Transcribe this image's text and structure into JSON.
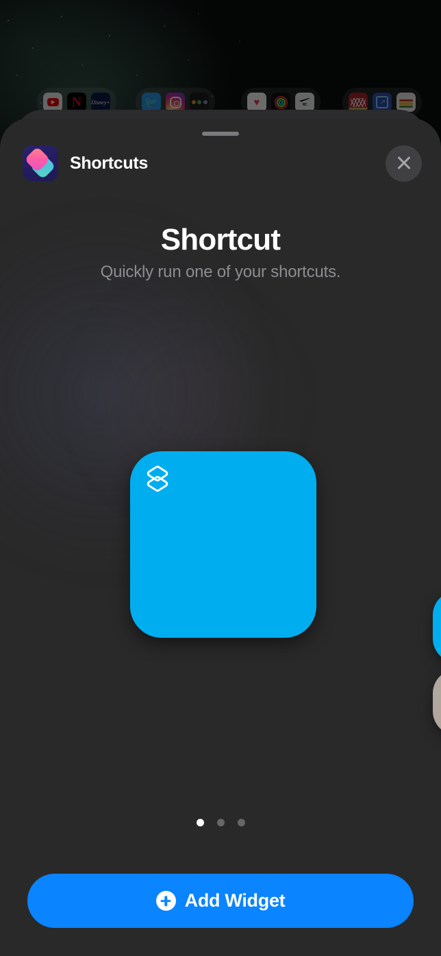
{
  "wallpaper": {
    "description": "dark starfield night sky",
    "home_screen_groups": [
      {
        "name": "entertainment-folder",
        "apps": [
          {
            "name": "YouTube",
            "icon": "youtube-icon"
          },
          {
            "name": "Netflix",
            "icon": "netflix-icon",
            "glyph": "N"
          },
          {
            "name": "Disney+",
            "icon": "disney-plus-icon",
            "glyph": "Disney+"
          }
        ]
      },
      {
        "name": "social-folder",
        "apps": [
          {
            "name": "Twitter",
            "icon": "twitter-icon",
            "glyph": "🐦"
          },
          {
            "name": "Instagram",
            "icon": "instagram-icon"
          },
          {
            "name": "Slack",
            "icon": "dots-icon"
          }
        ]
      },
      {
        "name": "fitness-folder",
        "apps": [
          {
            "name": "Health",
            "icon": "health-heart-icon",
            "glyph": "♥"
          },
          {
            "name": "Fitness",
            "icon": "activity-rings-icon"
          },
          {
            "name": "Nike Run Club",
            "icon": "nike-run-club-icon",
            "glyph": "RC"
          }
        ]
      },
      {
        "name": "utilities-folder",
        "apps": [
          {
            "name": "Red App",
            "icon": "red-app-icon"
          },
          {
            "name": "Blue App",
            "icon": "blue-app-icon",
            "glyph": "↗"
          },
          {
            "name": "Wallet",
            "icon": "wallet-icon"
          }
        ]
      }
    ]
  },
  "sheet": {
    "grabber": "drag-handle",
    "header": {
      "app_icon": "shortcuts-app-icon",
      "app_name": "Shortcuts",
      "close_label": "Close"
    },
    "hero": {
      "title": "Shortcut",
      "subtitle": "Quickly run one of your shortcuts."
    },
    "carousel": {
      "widget_glyph": "shortcuts-layers-icon",
      "widget_color": "#00AEEF",
      "peek_cards": [
        {
          "name": "peek-widget-blue",
          "color": "#00AEEF"
        },
        {
          "name": "peek-widget-tan",
          "color": "#B0A79F"
        }
      ]
    },
    "page_dots": {
      "total": 3,
      "active_index": 0
    },
    "add_button": {
      "label": "Add Widget",
      "icon": "plus-circle-icon",
      "color": "#0A84FF"
    }
  }
}
